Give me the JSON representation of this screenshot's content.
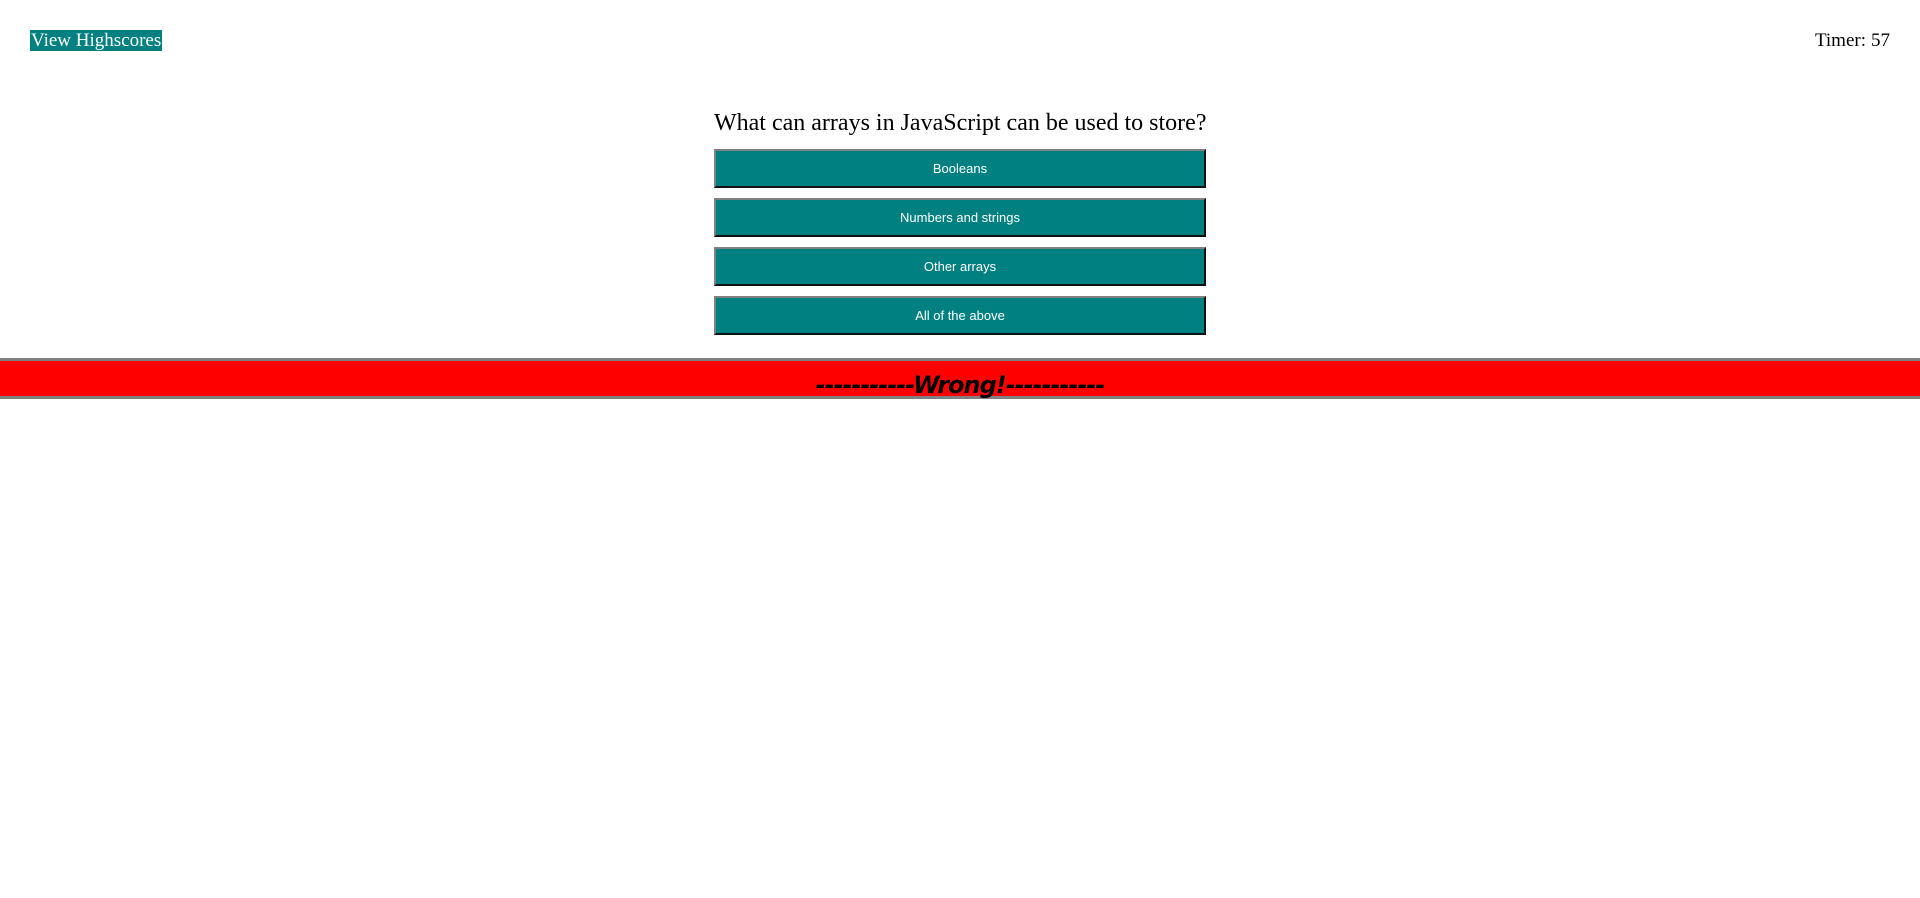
{
  "header": {
    "highscores_label": "View Highscores",
    "timer_label": "Timer:",
    "timer_value": "57"
  },
  "quiz": {
    "question": "What can arrays in JavaScript can be used to store?",
    "answers": [
      {
        "label": "Booleans"
      },
      {
        "label": "Numbers and strings"
      },
      {
        "label": "Other arrays"
      },
      {
        "label": "All of the above"
      }
    ]
  },
  "feedback": {
    "text": "-----------Wrong!-----------",
    "color": "#ff0000"
  },
  "colors": {
    "accent": "#008080",
    "feedback_wrong": "#ff0000"
  }
}
